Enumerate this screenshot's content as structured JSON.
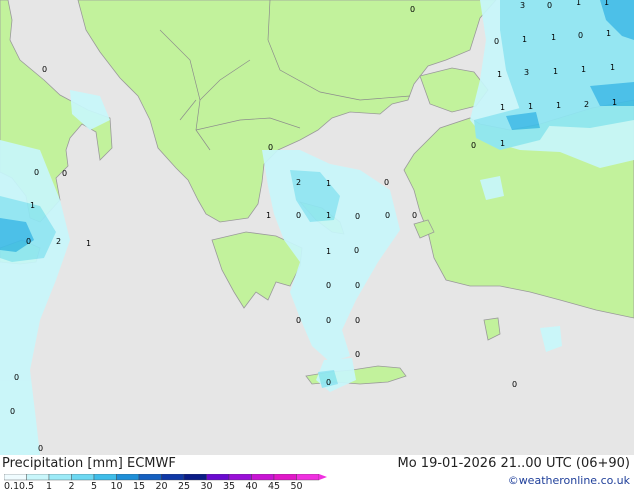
{
  "map": {
    "colors": {
      "sea": "#e6e6e6",
      "land": "#c2f29c",
      "coast": "#9a9a9a",
      "border": "#8c8c8c",
      "precip_light": "#c8f7fb",
      "precip_medium": "#8fe7f4",
      "precip_heavy": "#3fbde9"
    },
    "values": [
      {
        "text": "0"
      },
      {
        "text": "3"
      },
      {
        "text": "0"
      },
      {
        "text": "1"
      },
      {
        "text": "1"
      },
      {
        "text": "0"
      },
      {
        "text": "1"
      },
      {
        "text": "1"
      },
      {
        "text": "0"
      },
      {
        "text": "1"
      },
      {
        "text": "1"
      },
      {
        "text": "3"
      },
      {
        "text": "1"
      },
      {
        "text": "1"
      },
      {
        "text": "1"
      },
      {
        "text": "1"
      },
      {
        "text": "1"
      },
      {
        "text": "1"
      },
      {
        "text": "2"
      },
      {
        "text": "1"
      },
      {
        "text": "0"
      },
      {
        "text": "1"
      },
      {
        "text": "0"
      },
      {
        "text": "0"
      },
      {
        "text": "0"
      },
      {
        "text": "0"
      },
      {
        "text": "0"
      },
      {
        "text": "2"
      },
      {
        "text": "1"
      },
      {
        "text": "0"
      },
      {
        "text": "1"
      },
      {
        "text": "0"
      },
      {
        "text": "2"
      },
      {
        "text": "1"
      },
      {
        "text": "1"
      },
      {
        "text": "0"
      },
      {
        "text": "1"
      },
      {
        "text": "0"
      },
      {
        "text": "0"
      },
      {
        "text": "0"
      },
      {
        "text": "1"
      },
      {
        "text": "0"
      },
      {
        "text": "0"
      },
      {
        "text": "0"
      },
      {
        "text": "0"
      },
      {
        "text": "0"
      },
      {
        "text": "0"
      },
      {
        "text": "0"
      },
      {
        "text": "0"
      },
      {
        "text": "0"
      },
      {
        "text": "0"
      },
      {
        "text": "0"
      }
    ]
  },
  "footer": {
    "title": "Precipitation [mm]  ECMWF",
    "timestamp": "Mo 19-01-2026 21..00 UTC (06+90)",
    "credit": "©weatheronline.co.uk",
    "scale": [
      {
        "label": "0.1",
        "color": "#f0fcff"
      },
      {
        "label": "0.5",
        "color": "#c9f6fb"
      },
      {
        "label": "1",
        "color": "#9ceaf7"
      },
      {
        "label": "2",
        "color": "#6dd8f2"
      },
      {
        "label": "5",
        "color": "#3fbde9"
      },
      {
        "label": "10",
        "color": "#1f8fd8"
      },
      {
        "label": "15",
        "color": "#1560c0"
      },
      {
        "label": "20",
        "color": "#0f38a6"
      },
      {
        "label": "25",
        "color": "#0a1c86"
      },
      {
        "label": "30",
        "color": "#6a0ad0"
      },
      {
        "label": "35",
        "color": "#9a10d8"
      },
      {
        "label": "40",
        "color": "#c814d4"
      },
      {
        "label": "45",
        "color": "#e018c8"
      },
      {
        "label": "50",
        "color": "#f030e0"
      }
    ]
  }
}
